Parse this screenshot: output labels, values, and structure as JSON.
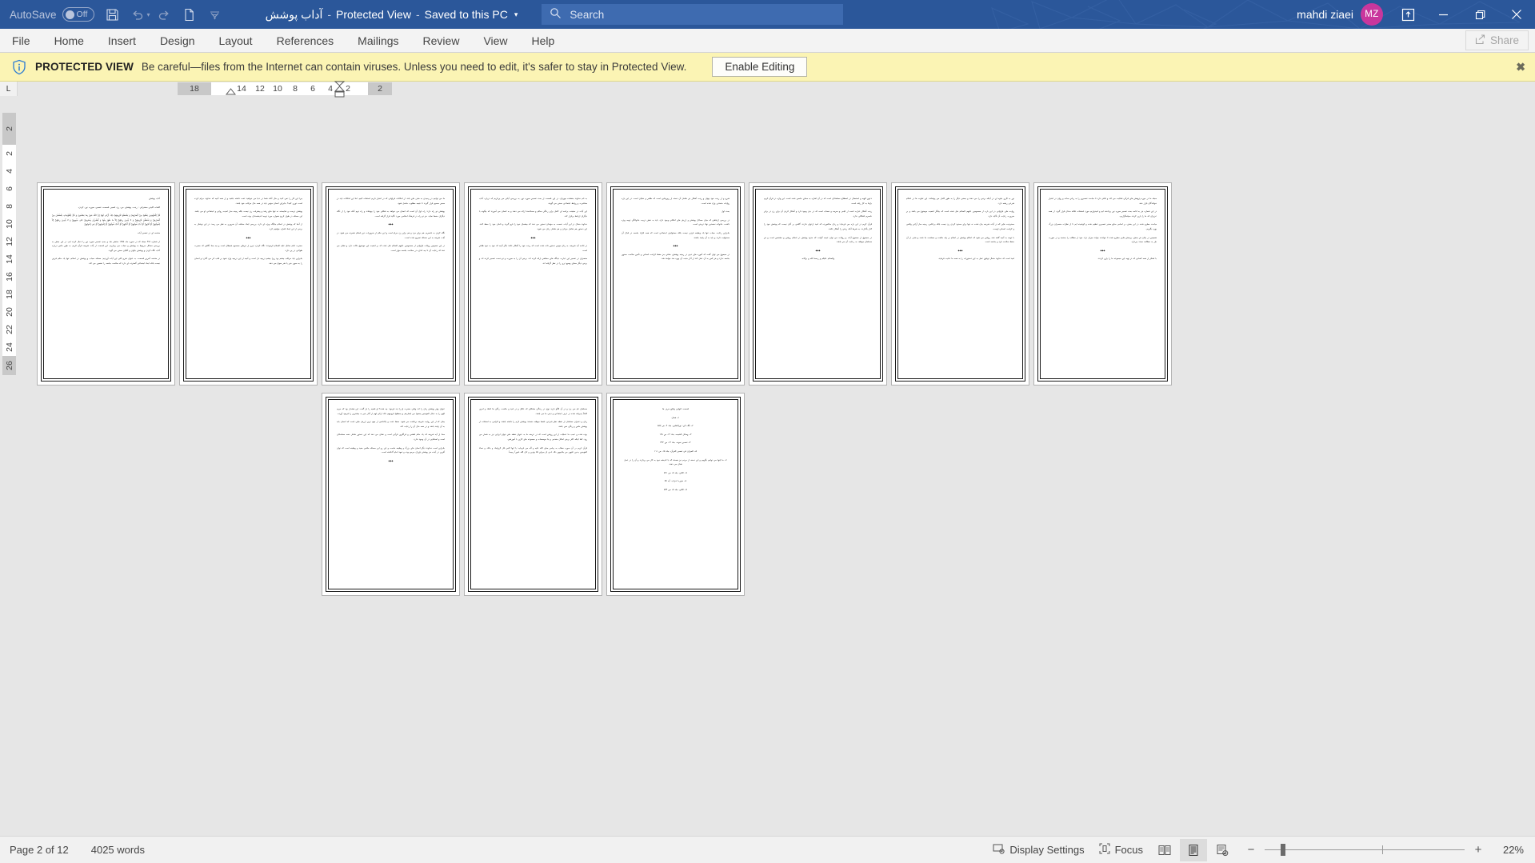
{
  "titlebar": {
    "autosave_label": "AutoSave",
    "autosave_state": "Off",
    "doc_name": "آداب پوشش",
    "sep1": "-",
    "protected_view": "Protected View",
    "sep2": "-",
    "saved_state": "Saved to this PC",
    "caret": "▾",
    "user_name": "mahdi ziaei",
    "avatar_initials": "MZ",
    "icons": {
      "save": "save-icon",
      "undo": "undo-icon",
      "redo": "redo-icon",
      "new": "new-document-icon",
      "customize": "customize-quick-access-toolbar-icon",
      "ribbon_display": "ribbon-display-options-icon",
      "minimize": "minimize-icon",
      "restore": "restore-icon",
      "close": "close-icon"
    },
    "accent_color": "#2b579a",
    "avatar_color": "#c9379d"
  },
  "search": {
    "placeholder": "Search",
    "value": "",
    "icon": "search-icon"
  },
  "ribbon": {
    "tabs": [
      {
        "label": "File"
      },
      {
        "label": "Home"
      },
      {
        "label": "Insert"
      },
      {
        "label": "Design"
      },
      {
        "label": "Layout"
      },
      {
        "label": "References"
      },
      {
        "label": "Mailings"
      },
      {
        "label": "Review"
      },
      {
        "label": "View"
      },
      {
        "label": "Help"
      }
    ],
    "share_label": "Share",
    "share_icon": "share-icon"
  },
  "protected_view": {
    "icon": "info-shield-icon",
    "title": "PROTECTED VIEW",
    "message": "Be careful—files from the Internet can contain viruses. Unless you need to edit, it's safer to stay in Protected View.",
    "button_label": "Enable Editing",
    "close_label": "✖",
    "bg_color": "#fbf4b4"
  },
  "ruler": {
    "tab_selector_glyph": "L",
    "horizontal_labels": [
      "18",
      "14",
      "12",
      "10",
      "8",
      "6",
      "4",
      "2",
      "2"
    ],
    "vertical_labels": [
      "2",
      "2",
      "4",
      "6",
      "8",
      "10",
      "12",
      "14",
      "16",
      "18",
      "20",
      "22",
      "24",
      "26"
    ],
    "markers": [
      "first-line-indent-marker",
      "hanging-indent-marker",
      "left-indent-marker"
    ]
  },
  "status": {
    "page_label": "Page 2 of 12",
    "word_count": "4025 words",
    "display_settings": "Display Settings",
    "display_settings_icon": "display-settings-icon",
    "focus": "Focus",
    "focus_icon": "focus-mode-icon",
    "view_read": "read-mode-icon",
    "view_print": "print-layout-icon",
    "view_web": "web-layout-icon",
    "zoom_out_label": "−",
    "zoom_in_label": "+",
    "zoom_percent": "22%"
  },
  "document": {
    "zoom": "22%",
    "total_pages": 12,
    "layout": "multi-page-thumbnail-grid",
    "rows": [
      {
        "pages": [
          {
            "number": 1,
            "paragraphs": [
              {
                "style": "head",
                "text": "آداب پوشش"
              },
              {
                "style": "head",
                "text": "كلمات كليدي سخنراني : زينت، پوشش، من، زن، قصير، قسمت، تفسير، سوره، نور، كردن،"
              },
              {
                "style": "ar",
                "text": "قُلْ لِلْمُؤْمِنِينَ يَغُضُّوا مِنْ أَبْصَارِهِمْ وَ يَحْفَظُوا فُرُوجَهُمْ ذلِكَ أَزْكى‏ لَهُمْ إِنَّ اللّهَ خَبِيرٌ بِما يَصْنَعُونَ وَ قُلْ لِلْمُؤْمِناتِ يَغْضُضْنَ مِنْ أَبْصارِهِنَّ وَ يَحْفَظْنَ فُرُوجَهُنَّ وَ لا يُبْدِينَ زِينَتَهُنَّ إِلاّ ما ظَهَرَ مِنْها وَ لْيَضْرِبْنَ بِخُمُرِهِنَّ عَلى‏ جُيُوبِهِنَّ وَ لا يُبْدِينَ زِينَتَهُنَّ إِلاّ لِبُعُولَتِهِنَّ أَوْ آبائِهِنَّ أَوْ آباءِ بُعُولَتِهِنَّ أَوْ أَبْنائِهِنَّ أَوْ أَبْناءِ بُعُولَتِهِنَّ أَوْ إِخْوانِهِنَّ أَوْ بَنِي إِخْوانِهِنَّ"
              },
              {
                "style": "head",
                "text": "مقدمه اي در تفسير آيات"
              },
              {
                "style": "body",
                "text": "از شماره ۴۹۶ مجله كه در سوره ماه ۱۳۷۵ منتشر شد و بحثِ تفسير سوره نور را دنبال كرده ايم. در اين بخش به بررسي مسائل مربوط به پوشش و حجاب مي پردازيم. اين قسمت از آيات شريفه قرآن كريم، به طور خاص درباره آداب نگاه كردن و پوشش بانوان و آقايان سخن مي گويد."
              },
              {
                "style": "body",
                "text": "در مقدمه آخرين قسمت، به عنوان شرح كلي اين آيات آورديم: مسئله حجاب و پوشش در اسلام، تنها يك حكم فردي نيست بلكه ابعاد اجتماعي گسترده اي دارد كه سلامت جامعه را تضمين مي كند."
              }
            ]
          },
          {
            "number": 2,
            "paragraphs": [
              {
                "style": "body",
                "text": "چرا اين كار را نمي كنيد و حال آنكه شما در دنيا مي خواهيد عفت داشته باشيد و از همه آنچه كه خداوند حرام كرده است دوري كنيد؟ بنابراين انسان مؤمن بايد در همه حال مراقب خود باشد."
              },
              {
                "style": "body",
                "text": "پوشش درست و شايسته، نه تنها مانع رشد و پيشرفت زن نيست بلكه زمينه ساز امنيت رواني و اجتماعي او مي باشد. اين مسئله در طول تاريخ همواره مورد توجه انديشمندان بوده است."
              },
              {
                "style": "body",
                "text": "از آنجا كه پوشش در اسلام جايگاه ويژه اي دارد، بررسي ابعاد مختلف آن ضروري به نظر مي رسد. در اين نوشتار به برخي از اين ابعاد اشاره خواهيم كرد."
              },
              {
                "style": "center",
                "text": "◆◆◆"
              },
              {
                "style": "body",
                "text": "حضرت امام صادق عليه السلام فرمودند: نگاه كردن، تيري از تيرهاي مسموم شيطان است و چه بسا نگاهي كه حسرت طولاني در پي دارد."
              },
              {
                "style": "body",
                "text": "بنابراين بايد مراقب چشم بود زيرا چشم دريچه دل است و آنچه از اين دريچه وارد شود بر قلب اثر مي گذارد و انسان را به سوي خير يا شر سوق مي دهد."
              }
            ]
          },
          {
            "number": 3,
            "paragraphs": [
              {
                "style": "body",
                "text": "ما مي توانيم در رسيدن به هدف هاي بلند، از امكانات فراواني كه در اختيار داريم استفاده كنيم. اما اين امكانات بايد در مسير صحيح قرار گيرند تا نتيجه مطلوب حاصل شود."
              },
              {
                "style": "body",
                "text": "پوشش دو راه دارد: راه اول آن است كه انسان مي خواهد به شكلي خود را بپوشاند و راه دوم آنكه خود را از نگاه ديگران حفظ نمايد. هر دو راه در فرهنگ اسلامي مورد تأكيد قرار گرفته است."
              },
              {
                "style": "center",
                "text": "◆◆◆"
              },
              {
                "style": "body",
                "text": "نگاه كردن به نامحرم، هم براي مرد و هم براي زن حرام است و اين حكم از ضروريات دين اسلام شمرده مي شود. در آيات شريفه به اين مسئله تصريح شده است."
              },
              {
                "style": "body",
                "text": "در اين خصوص روايات فراواني از معصومين عليهم السلام نقل شده كه بر اهميت اين موضوع دلالت دارد و نشان مي دهد كه رعايت آن تا چه اندازه در سلامت جامعه مؤثر است."
              }
            ]
          },
          {
            "number": 4,
            "paragraphs": [
              {
                "style": "body",
                "text": "به نام خداوند بخشنده مهربان. در اين قسمت از بحث تفسير سوره نور، به بررسي آياتي مي پردازيم كه درباره آداب معاشرت و روابط اجتماعي سخن مي گويند."
              },
              {
                "style": "body",
                "text": "اين آيات در حقيقت برنامه اي كامل براي زندگي سالم و سعادتمند ارائه مي دهند و به انسان مي آموزند كه چگونه با ديگران ارتباط برقرار كند."
              },
              {
                "style": "body",
                "text": "خداوند متعال در اين آيات، نخست به مؤمنان دستور مي دهد كه چشمان خود را فرو گيرند و دامان خود را حفظ كنند. اين دستور هم شامل مردان و هم شامل زنان مي شود."
              },
              {
                "style": "center",
                "text": "◆◆◆"
              },
              {
                "style": "body",
                "text": "در ادامه آيه شريفه، به زنان مؤمن دستور داده شده است كه زينت خود را آشكار نكنند مگر آنچه كه خود به خود ظاهر است."
              },
              {
                "style": "body",
                "text": "مفسران در تفسير اين عبارت ديدگاه هاي مختلفي ارائه كرده اند. برخي آن را به صورت و دو دست تفسير كرده اند و برخي ديگر معناي وسيع تري را در نظر گرفته اند."
              }
            ]
          },
          {
            "number": 5,
            "paragraphs": [
              {
                "style": "body",
                "text": "شرح و از زينت خود پنهان و زينت آشكار نيز شامل آن دسته از زيورهايي است كه ظاهر و نمايان است. در اين باره روايات متعددي وارد شده است."
              },
              {
                "style": "head",
                "text": "بحث اول"
              },
              {
                "style": "body",
                "text": "در بررسي ارتباطي كه ميان مسائل پوشش و ارزش هاي اخلاقي وجود دارد، بايد به نقش تربيت خانوادگي توجه ويژه داشت. خانواده نخستين نهاد تربيتي است."
              },
              {
                "style": "body",
                "text": "بنابراين رعايت حجاب تنها يك وظيفه فردي نيست بلكه مسئوليتي اجتماعي است كه همه افراد جامعه در قبال آن مسئوليت دارند و بايد به آن پايبند باشند."
              },
              {
                "style": "center",
                "text": "◆◆◆"
              },
              {
                "style": "body",
                "text": "در مجموع مي توان گفت كه آموزه هاي ديني در زمينه پوشش، هدفي جز حفظ كرامت انساني و تأمين سلامت معنوي جامعه ندارد و هر كس به آن عمل كند از آثار مثبت آن بهره مند خواهد شد."
              }
            ]
          },
          {
            "number": 6,
            "paragraphs": [
              {
                "style": "body",
                "text": "دعوي الهيه و استعمال در اصطلاح مسلمانان است كه در آن اشاره به معناي خاصي شده است. اين واژه در قرآن كريم بارها به كار رفته است."
              },
              {
                "style": "body",
                "text": "زينت آشكار عبارت است از لباس و سرمه و خضاب است كه در بدن وجود دارد و آشكار كردن آن براي زن در برابر نامحرم اشكالي ندارد."
              },
              {
                "style": "body",
                "text": "قرآن كريم در اين باره مي فرمايد: و زنان سالخورده كه اميد ازدواج ندارند، گناهي بر آنان نيست كه پوشش خود را كنار بگذارند، به شرط آنكه زينتي را آشكار نكنند."
              },
              {
                "style": "body",
                "text": "در مجموع از مجموع آيات و روايات مي توان نتيجه گرفت كه حدود پوشش در اسلام روشن و مشخص است و هر مسلمان موظف به رعايت آن مي باشد."
              },
              {
                "style": "center",
                "text": "◆◆◆"
              },
              {
                "style": "body",
                "text": "والسلام عليكم و رحمة الله و بركاته."
              }
            ]
          },
          {
            "number": 7,
            "paragraphs": [
              {
                "style": "body",
                "text": "نور به كاري جلوه اي در آينكه برخي را مي دهند و بعضي ديگر را به طور كامل مي پوشانند. اين تفاوت ها در احكام شرعي ريشه دارد."
              },
              {
                "style": "body",
                "text": "روايت هاي فراواني در اين باره از معصومين عليهم السلام نقل شده است كه بيانگر اهميت موضوع مي باشد و بر ضرورت رعايت آن تأكيد دارد."
              },
              {
                "style": "body",
                "text": "محدوديت هايي كه در آيات شريفه بيان شده، نه تنها براي محدود كردن زن نيست بلكه برعكس، زمينه ساز آزادي واقعي و كرامت انساني اوست."
              },
              {
                "style": "body",
                "text": "با توجه به آنچه گفته شد، روشن مي شود كه احكام پوشش در اسلام بر پايه حكمت و مصلحت بنا شده و هدف از آن حفظ سلامت فرد و جامعه است."
              },
              {
                "style": "center",
                "text": "◆◆◆"
              },
              {
                "style": "body",
                "text": "اميد است كه خداوند متعال توفيق عمل به اين دستورات را به همه ما عنايت فرمايد."
              }
            ]
          },
          {
            "number": 8,
            "paragraphs": [
              {
                "style": "body",
                "text": "مجله ما در حوزه پژوهش هاي قرآني فعاليت مي كند و تلاش دارد تا مباحث تفسيري را به زباني ساده و روان در اختيار خوانندگان قرار دهد."
              },
              {
                "style": "body",
                "text": "در اين شماره نيز به ادامه بحث تفسير سوره نور پرداخته ايم و اميدواريم مورد استفاده علاقه مندان قرار گيرد. از همه عزيزان كه ما را ياري كردند سپاسگزاريم."
              },
              {
                "style": "body",
                "text": "مباحث مطرح شده در اين بخش، بر اساس منابع معتبر تفسيري تنظيم شده و كوشيده ايم تا از نظرات مفسران بزرگ بهره بگيريم."
              },
              {
                "style": "body",
                "text": "همچنين در پايان هر بخش، پرسش هايي مطرح شده تا خواننده بتواند ميزان درك خود از مطالب را بسنجد و در صورت نياز به مطالعه مجدد بپردازد."
              },
              {
                "style": "center",
                "text": "◆◆◆"
              },
              {
                "style": "body",
                "text": "با تشكر از همه كساني كه در تهيه اين مجموعه ما را ياري كردند."
              }
            ]
          }
        ]
      },
      {
        "pages": [
          {
            "number": 9,
            "blank": true,
            "paragraphs": []
          },
          {
            "number": 10,
            "blank": true,
            "paragraphs": []
          },
          {
            "number": 11,
            "paragraphs": [
              {
                "style": "body",
                "text": "عنوان بهتر پوشش زنان را اند، وقتي حضرت او را ديد فرمود: چه شده؟ او قضيه را باز گفت. اين هشدار بود كه حريم الهي را به دنبال المؤمنين يغضوا من ابصارهم و يحفظوا فروجهم ذلك ازكي لهم از آغاز خير به بيشترين را فرمود آورده."
              },
              {
                "style": "body",
                "text": "چنان كه از اين روايت شريفه برداشت مي شود، حفظ عفت و پاكدامني از مهم ترين ارزش هايي است كه انسان بايد به آن پايبند باشد و در همه حال آن را رعايت كند."
              },
              {
                "style": "body",
                "text": "معنا از آيه شريفه كه يك حكم قطعي و فراگيري قرآني است و نشان مي دهد كه اين دستور شامل همه مسلمانان است و استثنايي در آن وجود ندارد."
              },
              {
                "style": "body",
                "text": "بنابراين است خداوند ديگر انسان هاي بزرگ و وظيفه ماست و اين رو اين مسئله حكمي مفيد و وظيفه است كه توان آفرين در آينده هر پوشش باوران مرمو بوده و تعهد امام گذاشته است."
              },
              {
                "style": "center",
                "text": "◆◆◆"
              }
            ]
          },
          {
            "number": 12,
            "paragraphs": [
              {
                "style": "body",
                "text": "مسلمان نام مي برد و در آن الگو داريد نوع، در زندگي مشكلي كه عاقل و در اميد و حكمت، رنگي ها انتقاد و امري كاملاً پذيرفته شده در عرف اجتماعي و ديني ما مي باشد."
              },
              {
                "style": "body",
                "text": "زنان و دختران مسلمان از نقطه نظر شرعي، فقط موظف هستند پوشش لازم را داشته باشند و الزامي به استفاده از پوشش خاص و رنگي نمي باشد."
              },
              {
                "style": "body",
                "text": "بوده شده و عجب ما عمليات از اين روشن است كه در عرضه ما به عنوان نقطه ملي بتوان ايراني نيز به شمار مي رود. كما اينكه اكثر برخي امكان مقدس و بنا موسسات و مجموعه هاي كاري با آموزشي."
              },
              {
                "style": "body",
                "text": "قرآن كريم در آن سوره خطاب به پيامبر صلي الله عليه و آله مي فرمايد: يا ايها النبي قل لازواجك و بناتك و نساء المؤمنين يدنين عليهن من جلابيبهن ذلك ادني ان يعرفن فلا يؤذين و كان الله غفوراً رحيماً."
              }
            ]
          },
          {
            "number": 13,
            "paragraphs": [
              {
                "style": "center",
                "text": "قسمت انتهايي وقايع حرف ها"
              },
              {
                "style": "center",
                "text": "۱ــ همان"
              },
              {
                "style": "center",
                "text": "۲ــ نگاه كن: نورالثقلين، جلد ۳، ص ۵۸۷"
              },
              {
                "style": "center",
                "text": "۳ــ وسائل الشيعه، جلد ۱۴، ص ۱۳۸"
              },
              {
                "style": "center",
                "text": "۴ــ تفسير نمونه، جلد ۱۴، ص ۴۴۳"
              },
              {
                "style": "center",
                "text": "۵ــ الميزان في تفسير القرآن، جلد ۱۵، ص ۱۱۱"
              },
              {
                "style": "center",
                "text": "۶ــ ما اينها مي توانيم بگوييم و اين دسته از مردم نيز هستند كه با انديشه خود به كار مي پردازند و آن را در عمل نشان مي دهند."
              },
              {
                "style": "center",
                "text": "۷ــ كافي، جلد ۵، ص ۵۲۱"
              },
              {
                "style": "center",
                "text": "۸ــ سوره احزاب، آيه ۵۹"
              },
              {
                "style": "center",
                "text": "۹ــ كافي، جلد ۵، ص ۵۳۴"
              }
            ]
          }
        ]
      }
    ]
  }
}
